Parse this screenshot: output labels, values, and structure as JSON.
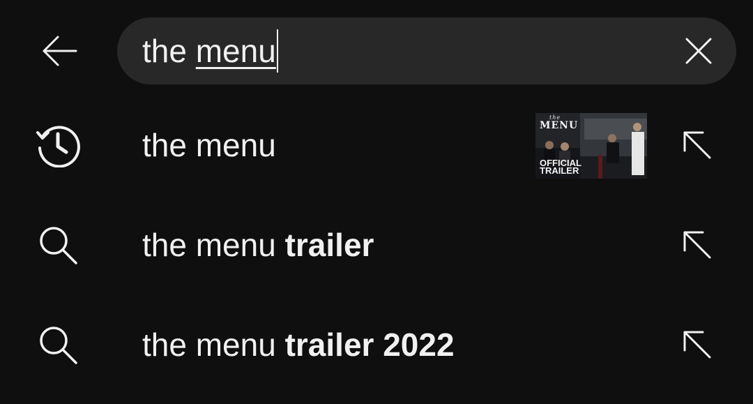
{
  "header": {
    "back_icon": "arrow-left-icon",
    "search": {
      "typed_plain": "the ",
      "typed_underlined": "menu",
      "clear_icon": "close-icon"
    }
  },
  "suggestions": [
    {
      "icon": "history-icon",
      "text_plain": "the menu",
      "text_bold": "",
      "has_thumbnail": true,
      "thumbnail": {
        "title_small": "the",
        "title_big": "MENU",
        "badge_line1": "OFFICIAL",
        "badge_line2": "TRAILER"
      },
      "action_icon": "arrow-up-left-icon"
    },
    {
      "icon": "search-icon",
      "text_plain": "the menu ",
      "text_bold": "trailer",
      "has_thumbnail": false,
      "action_icon": "arrow-up-left-icon"
    },
    {
      "icon": "search-icon",
      "text_plain": "the menu ",
      "text_bold": "trailer 2022",
      "has_thumbnail": false,
      "action_icon": "arrow-up-left-icon"
    }
  ],
  "colors": {
    "background": "#0f0f0f",
    "search_field": "#282828",
    "text": "#f1f1f1"
  }
}
